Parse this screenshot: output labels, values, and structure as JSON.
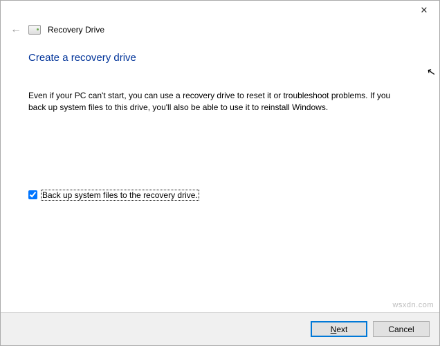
{
  "window": {
    "title": "Recovery Drive"
  },
  "page": {
    "heading": "Create a recovery drive",
    "description": "Even if your PC can't start, you can use a recovery drive to reset it or troubleshoot problems. If you back up system files to this drive, you'll also be able to use it to reinstall Windows."
  },
  "checkbox": {
    "checked": true,
    "label": "Back up system files to the recovery drive."
  },
  "buttons": {
    "next_prefix": "N",
    "next_suffix": "ext",
    "cancel": "Cancel"
  },
  "watermark": "wsxdn.com"
}
